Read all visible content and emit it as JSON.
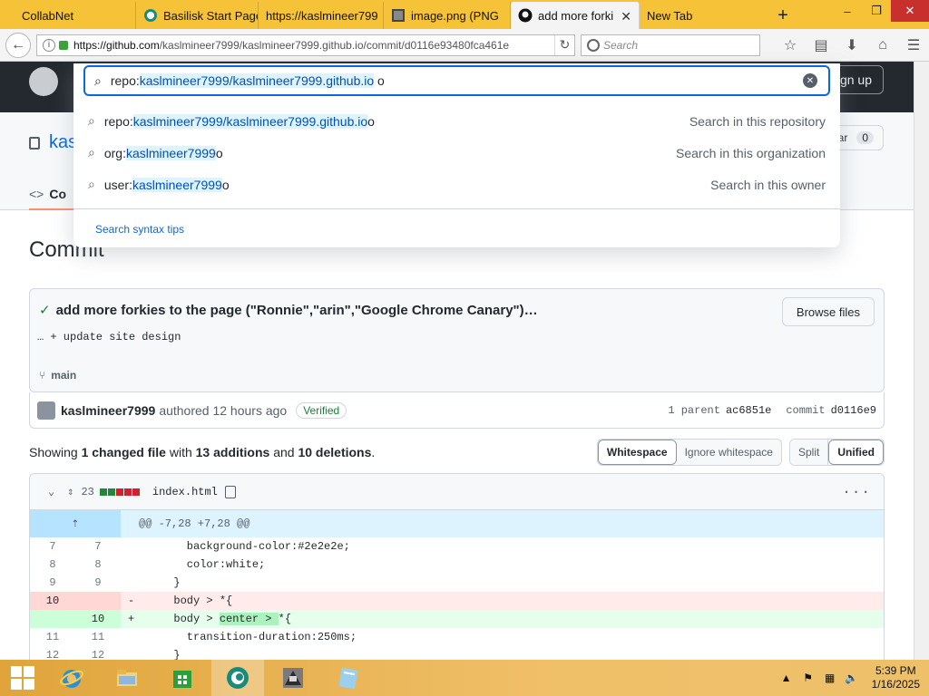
{
  "browser": {
    "tabs": [
      {
        "label": "CollabNet",
        "active": false
      },
      {
        "label": "Basilisk Start Page",
        "active": false
      },
      {
        "label": "https://kaslmineer799",
        "active": false
      },
      {
        "label": "image.png (PNG",
        "active": false
      },
      {
        "label": "add more forki",
        "active": true
      },
      {
        "label": "New Tab",
        "active": false
      }
    ],
    "new_tab": "+",
    "window_controls": {
      "minimize": "–",
      "restore": "❐",
      "close": "✕"
    },
    "url_host": "https://github.com",
    "url_path": "/kaslmineer7999/kaslmineer7999.github.io/commit/d0116e93480fca461e",
    "search_placeholder": "Search"
  },
  "github": {
    "signup": "ign up",
    "repo_name_fragment": "kas",
    "star_label": "ar",
    "star_count": "0",
    "code_tab": "Co",
    "page_title": "Commit"
  },
  "search": {
    "query_prefix": "repo:",
    "query_highlight": "kaslmineer7999/kaslmineer7999.github.io",
    "query_suffix": " o",
    "suggestions": [
      {
        "prefix": "repo:",
        "highlight": "kaslmineer7999/kaslmineer7999.github.io",
        "suffix": " o",
        "hint": "Search in this repository"
      },
      {
        "prefix": "org:",
        "highlight": "kaslmineer7999",
        "suffix": " o",
        "hint": "Search in this organization"
      },
      {
        "prefix": "user:",
        "highlight": "kaslmineer7999",
        "suffix": " o",
        "hint": "Search in this owner"
      }
    ],
    "tips": "Search syntax tips"
  },
  "commit": {
    "message": "add more forkies to the page (\"Ronnie\",\"arin\",\"Google Chrome Canary\")…",
    "browse_files": "Browse files",
    "body": "… + update site design",
    "branch": "main",
    "author": "kaslmineer7999",
    "authored": "authored 12 hours ago",
    "verified": "Verified",
    "parent_label": "1 parent",
    "parent_sha": "ac6851e",
    "commit_label": "commit",
    "commit_sha": "d0116e9"
  },
  "summary": {
    "prefix": "Showing ",
    "files": "1 changed file",
    "with": " with ",
    "additions": "13 additions",
    "and": " and ",
    "deletions": "10 deletions",
    "end": "."
  },
  "diff_toggles": {
    "whitespace": "Whitespace",
    "ignore_whitespace": "Ignore whitespace",
    "split": "Split",
    "unified": "Unified"
  },
  "file": {
    "changes": "23",
    "name": "index.html",
    "more": "···",
    "hunk": "@@ -7,28 +7,28 @@",
    "lines": [
      {
        "type": "ctx",
        "old": "7",
        "new": "7",
        "code": "         background-color:#2e2e2e;"
      },
      {
        "type": "ctx",
        "old": "8",
        "new": "8",
        "code": "         color:white;"
      },
      {
        "type": "ctx",
        "old": "9",
        "new": "9",
        "code": "       }"
      },
      {
        "type": "del",
        "old": "10",
        "new": "",
        "code": "-      body > *{"
      },
      {
        "type": "add",
        "old": "",
        "new": "10",
        "code_pre": "+      body > ",
        "code_hl": "center > ",
        "code_post": "*{"
      },
      {
        "type": "ctx",
        "old": "11",
        "new": "11",
        "code": "         transition-duration:250ms;"
      },
      {
        "type": "ctx",
        "old": "12",
        "new": "12",
        "code": "       }"
      }
    ]
  },
  "taskbar": {
    "time": "5:39 PM",
    "date": "1/16/2025"
  },
  "colors": {
    "accent": "#0969da",
    "add": "#1a7f37",
    "del": "#cf222e",
    "taskbar": "#e8b04f"
  }
}
